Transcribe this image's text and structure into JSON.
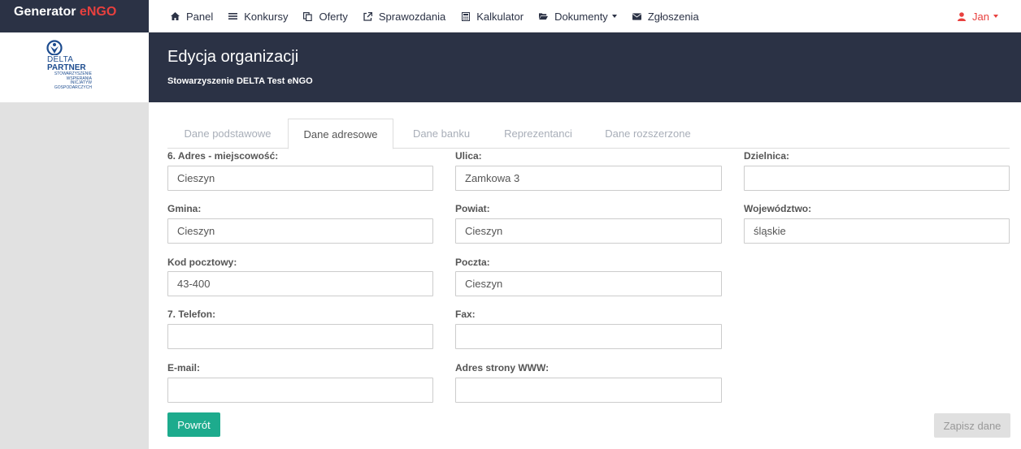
{
  "brand": {
    "name": "Generator",
    "accent": "eNGO"
  },
  "nav": [
    {
      "label": "Panel",
      "icon": "home-icon"
    },
    {
      "label": "Konkursy",
      "icon": "list-icon"
    },
    {
      "label": "Oferty",
      "icon": "copy-icon"
    },
    {
      "label": "Sprawozdania",
      "icon": "external-link-icon"
    },
    {
      "label": "Kalkulator",
      "icon": "calculator-icon"
    },
    {
      "label": "Dokumenty",
      "icon": "folder-open-icon",
      "dropdown": true
    },
    {
      "label": "Zgłoszenia",
      "icon": "envelope-icon"
    }
  ],
  "user": {
    "name": "Jan"
  },
  "logo": {
    "line1": "DELTA",
    "line2": "PARTNER",
    "tagline1": "STOWARZYSZENIE",
    "tagline2": "WSPIERANIA",
    "tagline3": "INICJATYW",
    "tagline4": "GOSPODARCZYCH"
  },
  "header": {
    "title": "Edycja organizacji",
    "subtitle": "Stowarzyszenie DELTA Test eNGO"
  },
  "tabs": [
    {
      "label": "Dane podstawowe",
      "active": false
    },
    {
      "label": "Dane adresowe",
      "active": true
    },
    {
      "label": "Dane banku",
      "active": false
    },
    {
      "label": "Reprezentanci",
      "active": false
    },
    {
      "label": "Dane rozszerzone",
      "active": false
    }
  ],
  "fields": {
    "miejscowosc": {
      "label": "6. Adres - miejscowość:",
      "value": "Cieszyn"
    },
    "ulica": {
      "label": "Ulica:",
      "value": "Zamkowa 3"
    },
    "dzielnica": {
      "label": "Dzielnica:",
      "value": ""
    },
    "gmina": {
      "label": "Gmina:",
      "value": "Cieszyn"
    },
    "powiat": {
      "label": "Powiat:",
      "value": "Cieszyn"
    },
    "wojewodztwo": {
      "label": "Województwo:",
      "value": "śląskie"
    },
    "kod": {
      "label": "Kod pocztowy:",
      "value": "43-400"
    },
    "poczta": {
      "label": "Poczta:",
      "value": "Cieszyn"
    },
    "telefon": {
      "label": "7. Telefon:",
      "value": ""
    },
    "fax": {
      "label": "Fax:",
      "value": ""
    },
    "email": {
      "label": "E-mail:",
      "value": ""
    },
    "www": {
      "label": "Adres strony WWW:",
      "value": ""
    }
  },
  "buttons": {
    "back": "Powrót",
    "save": "Zapisz dane"
  },
  "colors": {
    "navy": "#2b3245",
    "accent_red": "#e8403e",
    "teal": "#1dab8d",
    "sidebar_gray": "#e1e1e1"
  }
}
